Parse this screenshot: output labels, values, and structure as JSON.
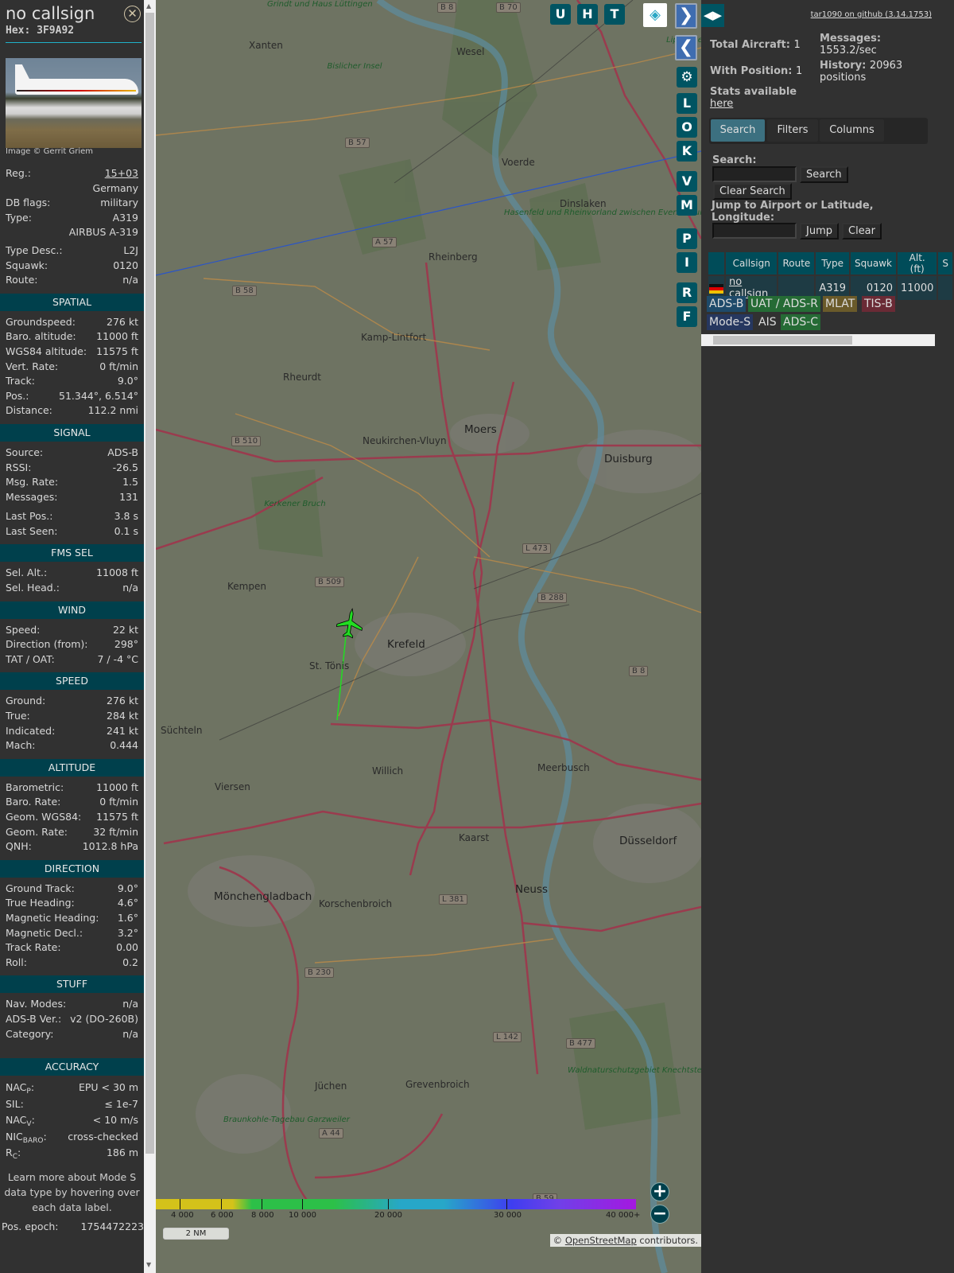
{
  "sidebar": {
    "title": "no callsign",
    "hex": "Hex:  3F9A92",
    "close_icon": "close-circle-icon",
    "image_credit": "Image © Gerrit Griem",
    "info": [
      {
        "label": "Reg.:",
        "value": "15+03"
      },
      {
        "label": "",
        "value": "Germany"
      },
      {
        "label": "DB flags:",
        "value": "military"
      },
      {
        "label": "Type:",
        "value": "A319"
      },
      {
        "label": "",
        "value": "AIRBUS A-319"
      },
      {
        "label": "Type Desc.:",
        "value": "L2J"
      },
      {
        "label": "Squawk:",
        "value": "0120"
      },
      {
        "label": "Route:",
        "value": "n/a"
      }
    ],
    "sections": {
      "spatial": {
        "title": "SPATIAL",
        "rows": [
          {
            "label": "Groundspeed:",
            "value": "276 kt"
          },
          {
            "label": "Baro. altitude:",
            "value": "11000 ft"
          },
          {
            "label": "WGS84 altitude:",
            "value": "11575 ft"
          },
          {
            "label": "Vert. Rate:",
            "value": "0 ft/min"
          },
          {
            "label": "Track:",
            "value": "9.0°"
          },
          {
            "label": "Pos.:",
            "value": "51.344°, 6.514°"
          },
          {
            "label": "Distance:",
            "value": "112.2 nmi"
          }
        ]
      },
      "signal": {
        "title": "SIGNAL",
        "rows": [
          {
            "label": "Source:",
            "value": "ADS-B"
          },
          {
            "label": "RSSI:",
            "value": "-26.5"
          },
          {
            "label": "Msg. Rate:",
            "value": "1.5"
          },
          {
            "label": "Messages:",
            "value": "131"
          },
          {
            "label": "Last Pos.:",
            "value": "3.8 s"
          },
          {
            "label": "Last Seen:",
            "value": "0.1 s"
          }
        ]
      },
      "fms": {
        "title": "FMS SEL",
        "rows": [
          {
            "label": "Sel. Alt.:",
            "value": "11008 ft"
          },
          {
            "label": "Sel. Head.:",
            "value": "n/a"
          }
        ]
      },
      "wind": {
        "title": "WIND",
        "rows": [
          {
            "label": "Speed:",
            "value": "22 kt"
          },
          {
            "label": "Direction (from):",
            "value": "298°"
          },
          {
            "label": "TAT / OAT:",
            "value": "7 / -4 °C"
          }
        ]
      },
      "speed": {
        "title": "SPEED",
        "rows": [
          {
            "label": "Ground:",
            "value": "276 kt"
          },
          {
            "label": "True:",
            "value": "284 kt"
          },
          {
            "label": "Indicated:",
            "value": "241 kt"
          },
          {
            "label": "Mach:",
            "value": "0.444"
          }
        ]
      },
      "altitude": {
        "title": "ALTITUDE",
        "rows": [
          {
            "label": "Barometric:",
            "value": "11000 ft"
          },
          {
            "label": "Baro. Rate:",
            "value": "0 ft/min"
          },
          {
            "label": "Geom. WGS84:",
            "value": "11575 ft"
          },
          {
            "label": "Geom. Rate:",
            "value": "32 ft/min"
          },
          {
            "label": "QNH:",
            "value": "1012.8 hPa"
          }
        ]
      },
      "direction": {
        "title": "DIRECTION",
        "rows": [
          {
            "label": "Ground Track:",
            "value": "9.0°"
          },
          {
            "label": "True Heading:",
            "value": "4.6°"
          },
          {
            "label": "Magnetic Heading:",
            "value": "1.6°"
          },
          {
            "label": "Magnetic Decl.:",
            "value": "3.2°"
          },
          {
            "label": "Track Rate:",
            "value": "0.00"
          },
          {
            "label": "Roll:",
            "value": "0.2"
          }
        ]
      },
      "stuff": {
        "title": "STUFF",
        "rows": [
          {
            "label": "Nav. Modes:",
            "value": "n/a"
          },
          {
            "label": "ADS-B Ver.:",
            "value": "v2 (DO-260B)"
          },
          {
            "label": "Category:",
            "value": "n/a"
          }
        ]
      },
      "accuracy": {
        "title": "ACCURACY",
        "nacp": {
          "label": "NAC",
          "sub": "P",
          "value": "EPU < 30 m"
        },
        "sil": {
          "label": "SIL:",
          "value": "≤ 1e-7"
        },
        "nacv": {
          "label": "NAC",
          "sub": "V",
          "value": "< 10 m/s"
        },
        "nicbaro": {
          "label": "NIC",
          "sub": "BARO",
          "value": "cross-checked"
        },
        "rc": {
          "label": "R",
          "sub": "C",
          "value": "186 m"
        }
      }
    },
    "learn_more": "Learn more about Mode S data type by hovering over each data label.",
    "pos_epoch": {
      "label": "Pos. epoch:",
      "value": "1754472223"
    }
  },
  "map": {
    "buttons_top": [
      "U",
      "H",
      "T"
    ],
    "buttons_side": [
      "L",
      "O",
      "K",
      "V",
      "M",
      "P",
      "I",
      "R",
      "F"
    ],
    "places": [
      {
        "name": "Xanten",
        "cls": "",
        "x": "x1"
      },
      {
        "name": "Wesel"
      },
      {
        "name": "Voerde"
      },
      {
        "name": "Dinslaken"
      },
      {
        "name": "Rheinberg"
      },
      {
        "name": "Kamp-Lintfort"
      },
      {
        "name": "Rheurdt"
      },
      {
        "name": "Neukirchen-Vluyn"
      },
      {
        "name": "Moers"
      },
      {
        "name": "Duisburg"
      },
      {
        "name": "Kempen"
      },
      {
        "name": "Krefeld"
      },
      {
        "name": "St. Tönis"
      },
      {
        "name": "Süchteln"
      },
      {
        "name": "Willich"
      },
      {
        "name": "Meerbusch"
      },
      {
        "name": "Viersen"
      },
      {
        "name": "Kaarst"
      },
      {
        "name": "Düsseldorf"
      },
      {
        "name": "Neuss"
      },
      {
        "name": "Mönchengladbach"
      },
      {
        "name": "Korschenbroich"
      },
      {
        "name": "Jüchen"
      },
      {
        "name": "Grevenbroich"
      },
      {
        "name": "Lippeaue"
      },
      {
        "name": "Bislicher Insel"
      },
      {
        "name": "Hasenfeld und Rheinvorland zwischen Eversael und Ossenberg"
      },
      {
        "name": "Kerkener Bruch"
      },
      {
        "name": "Braunkohle-Tagebau Garzweiler"
      },
      {
        "name": "Waldnaturschutzgebiet Knechtsteden"
      },
      {
        "name": "Grindt und Haus Lüttingen"
      }
    ],
    "road_shields": [
      "B 8",
      "B 70",
      "B 57",
      "A 57",
      "B 58",
      "B 510",
      "L 473",
      "B 509",
      "B 288",
      "B 8",
      "L 381",
      "B 230",
      "L 142",
      "B 477",
      "A 44",
      "B 59"
    ],
    "altitude_legend": [
      "4 000",
      "6 000",
      "8 000",
      "10 000",
      "20 000",
      "30 000",
      "40 000+"
    ],
    "scale": "2 NM",
    "attribution_prefix": "© ",
    "attribution_link": "OpenStreetMap",
    "attribution_suffix": " contributors.",
    "aircraft_color": "#22dd22"
  },
  "panel": {
    "github": "tar1090 on github (3.14.1753)",
    "total_aircraft": {
      "label": "Total Aircraft:",
      "value": "1"
    },
    "with_position": {
      "label": "With Position:",
      "value": "1"
    },
    "messages": {
      "label": "Messages:",
      "value": "1553.2/sec"
    },
    "history": {
      "label": "History:",
      "value": "20963",
      "unit": "positions"
    },
    "stats_text": "Stats available",
    "stats_link": "here",
    "tabs": [
      "Search",
      "Filters",
      "Columns"
    ],
    "search_label": "Search:",
    "search_value": "",
    "search_button": "Search",
    "clear_search_button": "Clear Search",
    "jump_label": "Jump to Airport or Latitude, Longitude:",
    "jump_value": "",
    "jump_button": "Jump",
    "clear_button": "Clear",
    "table": {
      "headers": [
        "",
        "Callsign",
        "Route",
        "Type",
        "Squawk",
        "Alt. (ft)",
        "S"
      ],
      "rows": [
        {
          "flag": "Germany",
          "callsign": "no callsign",
          "route": "",
          "type": "A319",
          "squawk": "0120",
          "alt": "11000",
          "s": ""
        }
      ]
    },
    "legend": [
      {
        "label": "ADS-B",
        "color": "#1e4a6a"
      },
      {
        "label": "UAT / ADS-R",
        "color": "#256b35"
      },
      {
        "label": "MLAT",
        "color": "#6a5a2a"
      },
      {
        "label": "TIS-B",
        "color": "#6a2a35"
      },
      {
        "label": "Mode-S",
        "color": "#26375f"
      },
      {
        "label": "AIS",
        "color": "#313131"
      },
      {
        "label": "ADS-C",
        "color": "#256b35"
      }
    ]
  }
}
